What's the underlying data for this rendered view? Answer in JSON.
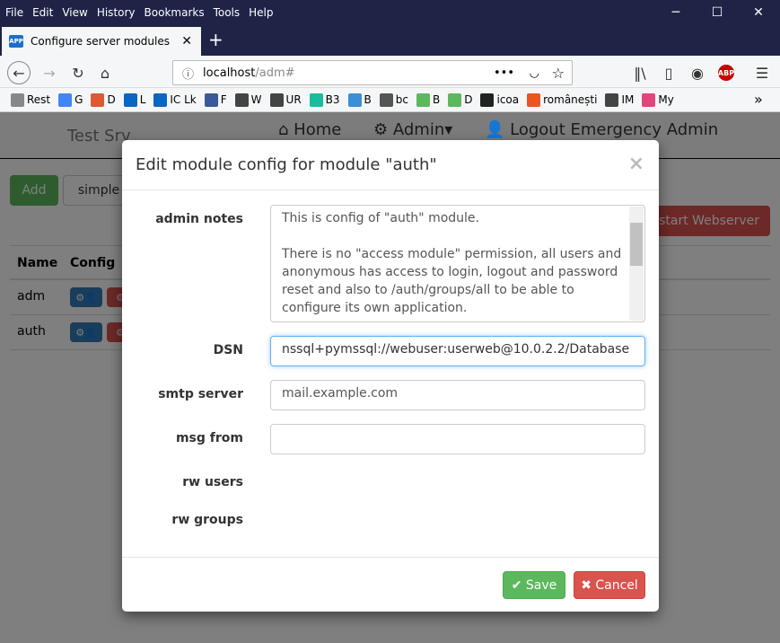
{
  "menu": [
    "File",
    "Edit",
    "View",
    "History",
    "Bookmarks",
    "Tools",
    "Help"
  ],
  "tab": {
    "icon": "APP",
    "title": "Configure server modules"
  },
  "url": {
    "host": "localhost",
    "path": "/adm#"
  },
  "bookmarks": [
    {
      "icon": "folder",
      "label": "Rest",
      "color": "#888"
    },
    {
      "icon": "google",
      "label": "G",
      "color": "#4285f4"
    },
    {
      "icon": "duckduckgo",
      "label": "D",
      "color": "#de5833"
    },
    {
      "icon": "linkedin",
      "label": "L",
      "color": "#0a66c2"
    },
    {
      "icon": "linkedin",
      "label": "IC Lk",
      "color": "#0a66c2"
    },
    {
      "icon": "facebook",
      "label": "F",
      "color": "#3b5998"
    },
    {
      "icon": "globe",
      "label": "W",
      "color": "#444"
    },
    {
      "icon": "globe",
      "label": "UR",
      "color": "#444"
    },
    {
      "icon": "b3",
      "label": "B3",
      "color": "#1abc9c"
    },
    {
      "icon": "b",
      "label": "B",
      "color": "#3a8fd6"
    },
    {
      "icon": "bc",
      "label": "bc",
      "color": "#555"
    },
    {
      "icon": "w3",
      "label": "B",
      "color": "#5cb85c"
    },
    {
      "icon": "w3",
      "label": "D",
      "color": "#5cb85c"
    },
    {
      "icon": "github",
      "label": "icoa",
      "color": "#222"
    },
    {
      "icon": "ubuntu",
      "label": "românești",
      "color": "#e95420"
    },
    {
      "icon": "globe",
      "label": "IM",
      "color": "#444"
    },
    {
      "icon": "heart",
      "label": "My",
      "color": "#e0457b"
    }
  ],
  "app": {
    "brand": "Test Srv",
    "nav": [
      "Home",
      "Admin",
      "Logout Emergency Admin"
    ],
    "add": "Add",
    "simple": "simple",
    "restart": "start Webserver",
    "columns": [
      "Name",
      "Config"
    ],
    "rows": [
      "adm",
      "auth"
    ]
  },
  "modal": {
    "title": "Edit module config for module \"auth\"",
    "close": "×",
    "fields": {
      "admin_notes_label": "admin notes",
      "admin_notes": "This is config of \"auth\" module.\n\nThere is no \"access module\" permission, all users and anonymous has access to login, logout and password reset and also to /auth/groups/all to be able to configure its own application.",
      "dsn_label": "DSN",
      "dsn": "nssql+pymssql://webuser:userweb@10.0.2.2/Database",
      "smtp_label": "smtp server",
      "smtp": "mail.example.com",
      "msg_from_label": "msg from",
      "msg_from": "",
      "rw_users_label": "rw users",
      "rw_groups_label": "rw groups"
    },
    "save": "Save",
    "cancel": "Cancel"
  },
  "colors": {
    "primary": "#337ab7",
    "success": "#5cb85c",
    "danger": "#d9534f"
  }
}
